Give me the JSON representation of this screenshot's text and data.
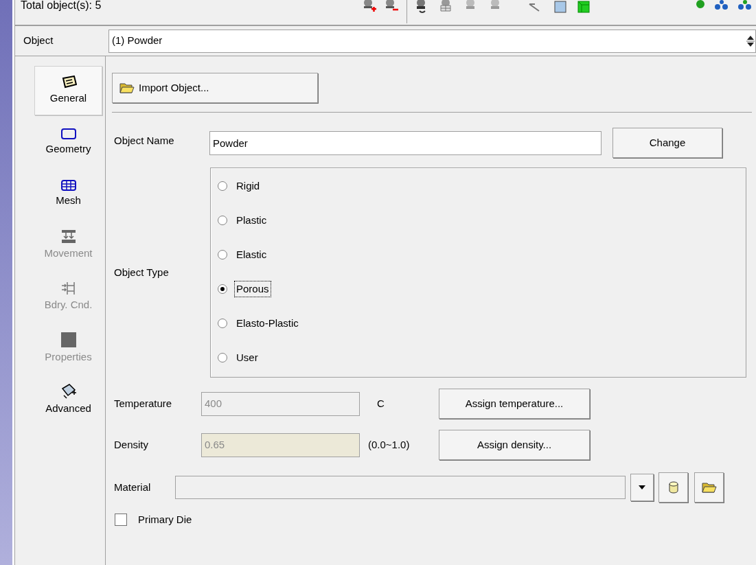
{
  "status": "Total object(s): 5",
  "object_selector": {
    "label": "Object",
    "value": "(1) Powder"
  },
  "sidebar": {
    "items": [
      {
        "kind": "general",
        "label": "General",
        "selected": true,
        "disabled": false
      },
      {
        "kind": "geometry",
        "label": "Geometry",
        "selected": false,
        "disabled": false
      },
      {
        "kind": "mesh",
        "label": "Mesh",
        "selected": false,
        "disabled": false
      },
      {
        "kind": "movement",
        "label": "Movement",
        "selected": false,
        "disabled": true
      },
      {
        "kind": "boundary",
        "label": "Bdry. Cnd.",
        "selected": false,
        "disabled": true
      },
      {
        "kind": "properties",
        "label": "Properties",
        "selected": false,
        "disabled": true
      },
      {
        "kind": "advanced",
        "label": "Advanced",
        "selected": false,
        "disabled": false
      }
    ]
  },
  "import_button": "Import Object...",
  "object_name": {
    "label": "Object Name",
    "value": "Powder",
    "button": "Change"
  },
  "object_type": {
    "label": "Object Type",
    "options": [
      {
        "label": "Rigid",
        "selected": false,
        "focused": false
      },
      {
        "label": "Plastic",
        "selected": false,
        "focused": false
      },
      {
        "label": "Elastic",
        "selected": false,
        "focused": false
      },
      {
        "label": "Porous",
        "selected": true,
        "focused": true
      },
      {
        "label": "Elasto-Plastic",
        "selected": false,
        "focused": false
      },
      {
        "label": "User",
        "selected": false,
        "focused": false
      }
    ]
  },
  "temperature": {
    "label": "Temperature",
    "value": "400",
    "disabled": true,
    "unit": "C",
    "button": "Assign temperature..."
  },
  "density": {
    "label": "Density",
    "value": "0.65",
    "disabled": true,
    "unit": "(0.0~1.0)",
    "button": "Assign density..."
  },
  "material": {
    "label": "Material"
  },
  "primary_die": {
    "label": "Primary Die",
    "checked": false
  }
}
